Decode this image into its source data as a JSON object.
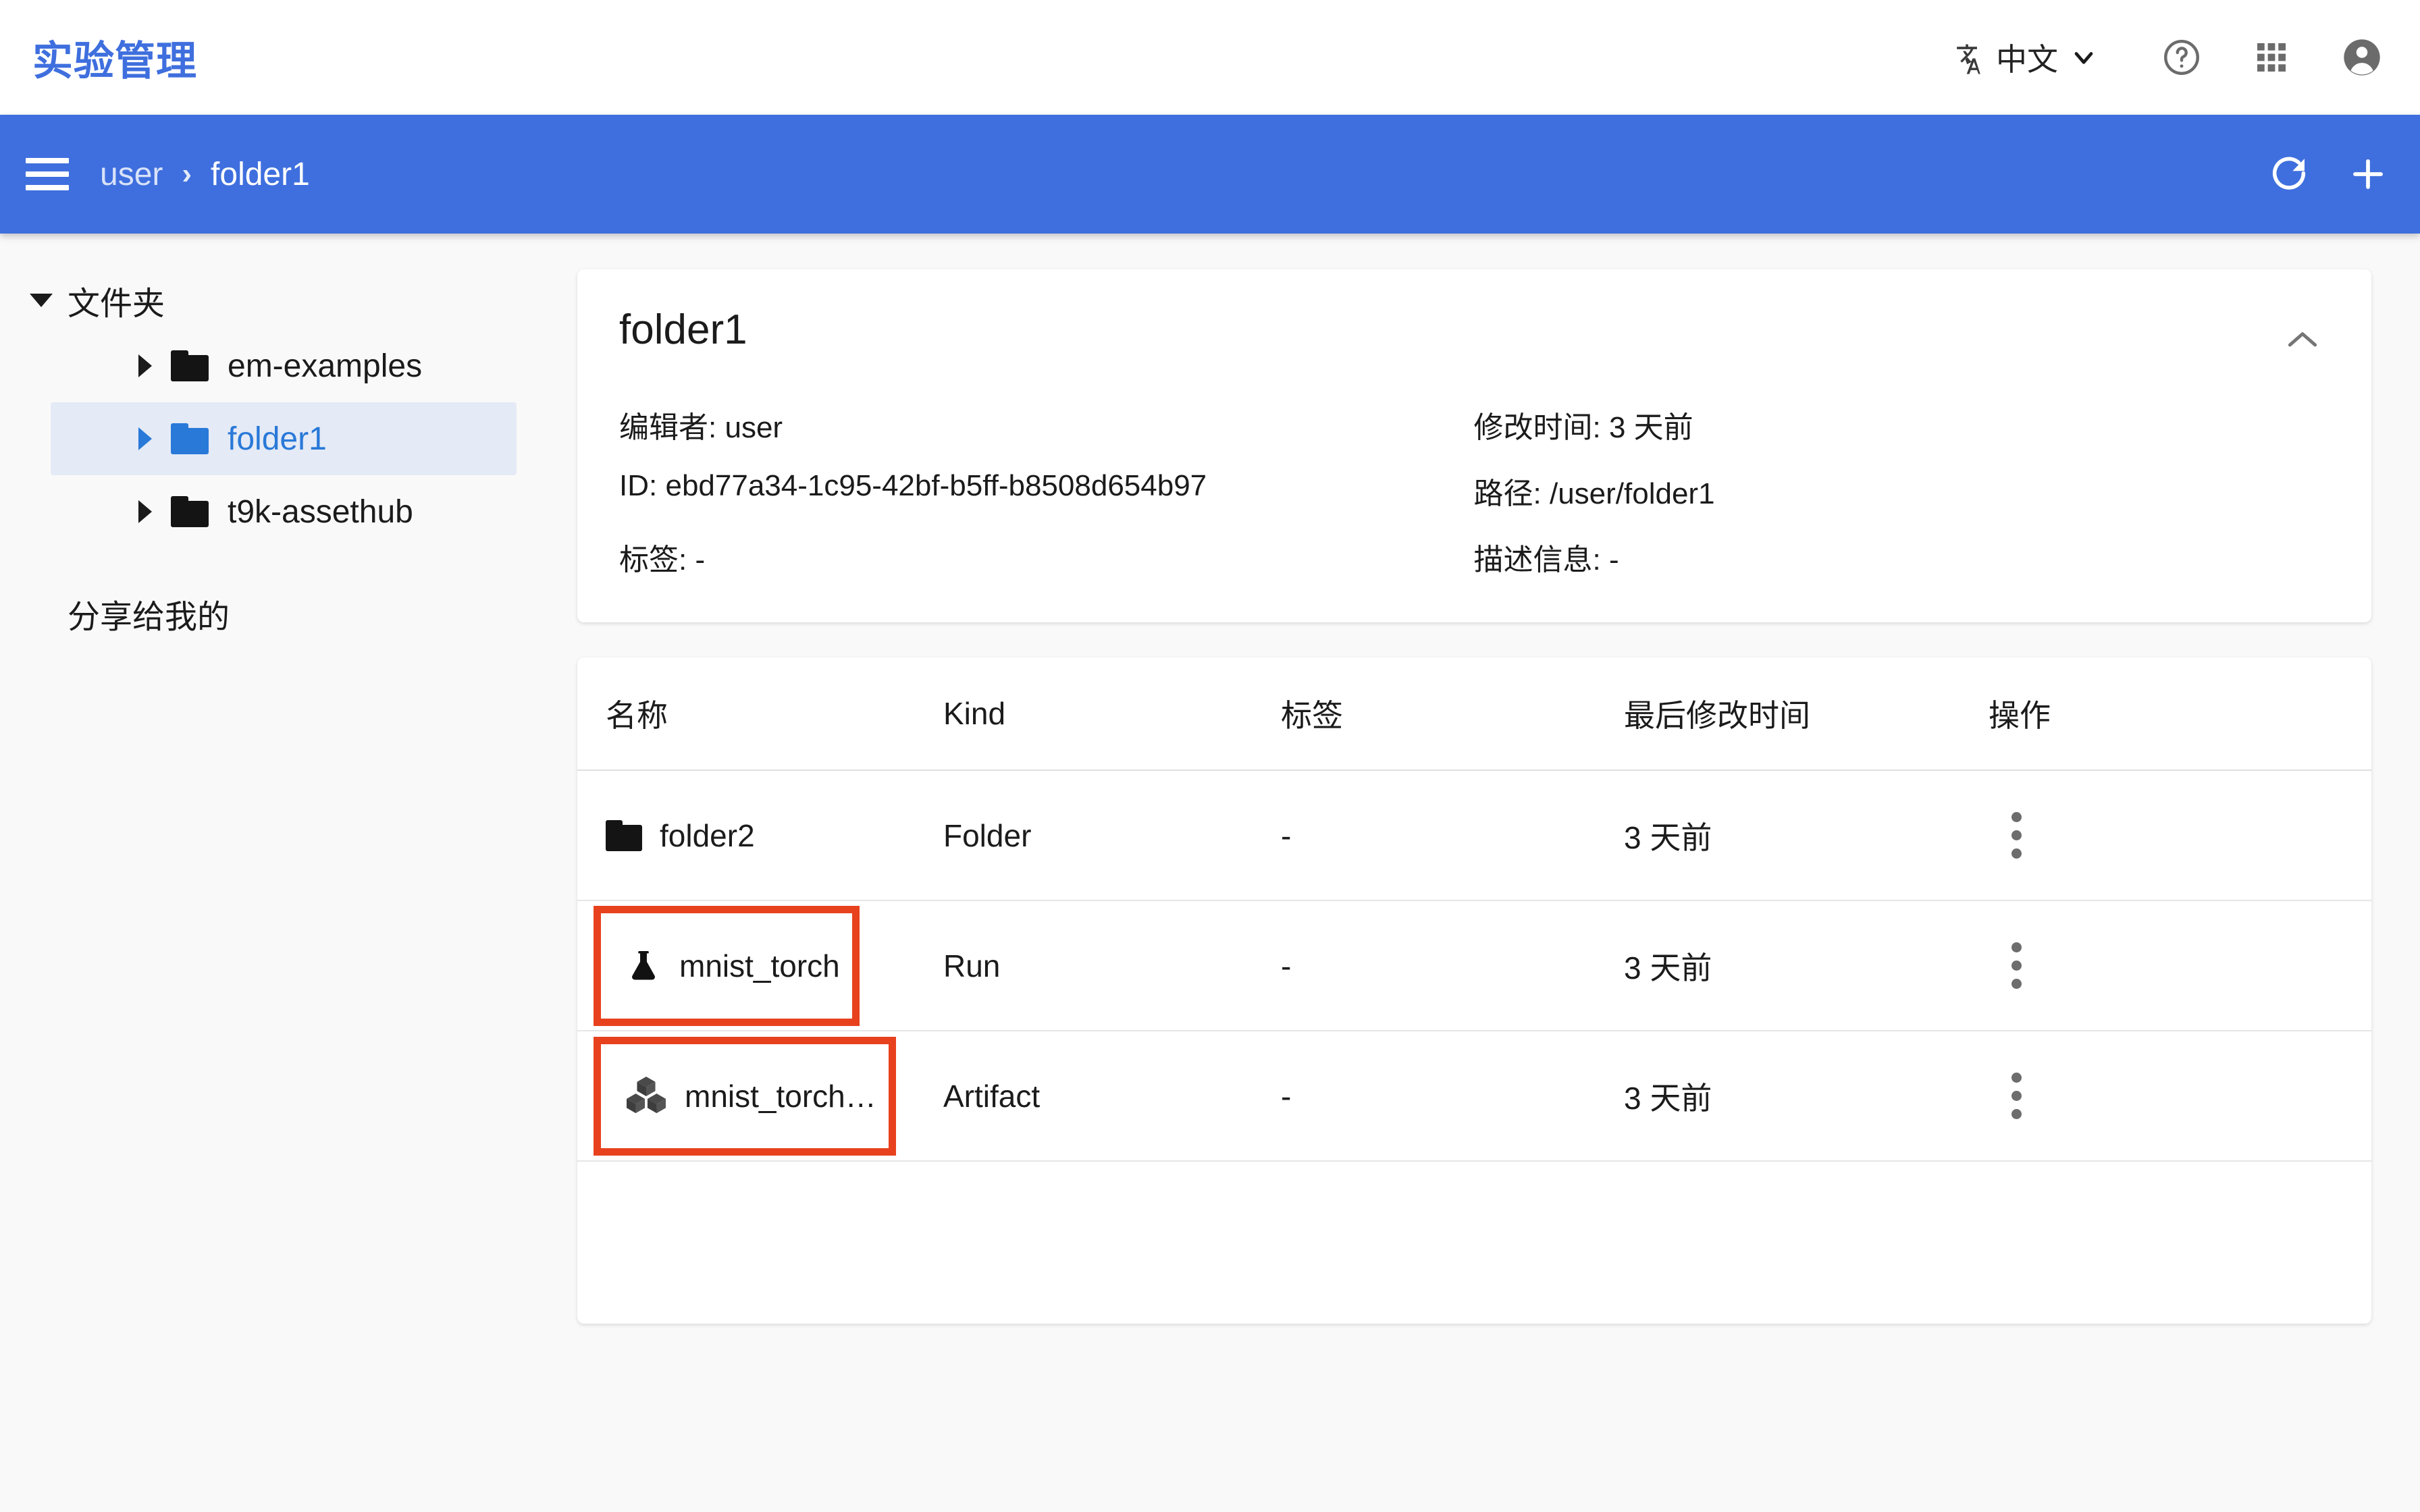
{
  "header": {
    "app_title": "实验管理",
    "language": "中文",
    "icons": {
      "translate": "translate-icon",
      "chevron_down": "chevron-down-icon",
      "help": "help-circle-icon",
      "apps": "apps-grid-icon",
      "account": "account-circle-icon"
    }
  },
  "breadcrumb": {
    "menu_icon": "hamburger-menu-icon",
    "items": [
      "user",
      "folder1"
    ],
    "separator": "›",
    "refresh_icon": "refresh-icon",
    "add_icon": "plus-icon"
  },
  "sidebar": {
    "root_label": "文件夹",
    "items": [
      {
        "label": "em-examples",
        "selected": false
      },
      {
        "label": "folder1",
        "selected": true
      },
      {
        "label": "t9k-assethub",
        "selected": false
      }
    ],
    "shared_label": "分享给我的"
  },
  "detail": {
    "title": "folder1",
    "fields": [
      {
        "label": "编辑者:",
        "value": "user"
      },
      {
        "label": "修改时间:",
        "value": "3 天前"
      },
      {
        "label": "ID:",
        "value": "ebd77a34-1c95-42bf-b5ff-b8508d654b97"
      },
      {
        "label": "路径:",
        "value": "/user/folder1"
      },
      {
        "label": "标签:",
        "value": "-"
      },
      {
        "label": "描述信息:",
        "value": "-"
      }
    ]
  },
  "table": {
    "columns": [
      "名称",
      "Kind",
      "标签",
      "最后修改时间",
      "操作"
    ],
    "rows": [
      {
        "name": "folder2",
        "icon": "folder-icon",
        "kind": "Folder",
        "tag": "-",
        "modified": "3 天前",
        "highlighted": false
      },
      {
        "name": "mnist_torch",
        "icon": "flask-icon",
        "kind": "Run",
        "tag": "-",
        "modified": "3 天前",
        "highlighted": true
      },
      {
        "name": "mnist_torch…",
        "icon": "cubes-icon",
        "kind": "Artifact",
        "tag": "-",
        "modified": "3 天前",
        "highlighted": true
      }
    ]
  },
  "colors": {
    "brand_blue": "#3F6FDE",
    "link_blue": "#2979d8",
    "highlight_red": "#E8411E",
    "selected_bg": "#e4eaf6",
    "page_bg": "#f9f9f9"
  }
}
